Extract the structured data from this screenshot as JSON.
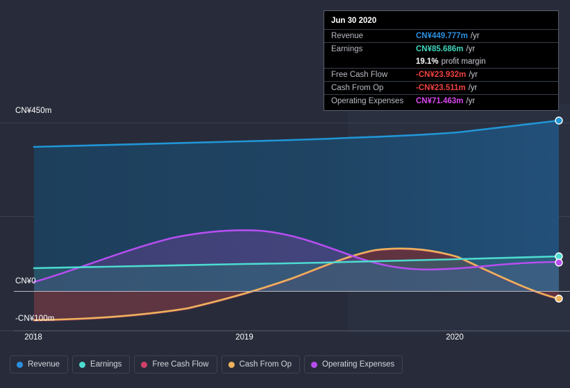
{
  "chart_data": {
    "type": "area",
    "title": "",
    "xlabel": "",
    "ylabel": "",
    "currency_prefix": "CN¥",
    "x_ticks": [
      "2018",
      "2019",
      "2020"
    ],
    "x_tick_positions": [
      48,
      352,
      655
    ],
    "y_ticks": [
      "CN¥450m",
      "CN¥0",
      "-CN¥100m"
    ],
    "y_tick_values": [
      450,
      0,
      -100
    ],
    "ylim": [
      -140,
      500
    ],
    "grid": true,
    "legend_position": "bottom-left",
    "units": "CN¥ millions per year",
    "x_range": [
      "2018-01-01",
      "2020-09-30"
    ],
    "marker_date": "Jun 30 2020",
    "series": [
      {
        "name": "Revenue",
        "color": "#2196d6",
        "fill": "#1f4261",
        "x": [
          2018.0,
          2018.5,
          2019.0,
          2019.5,
          2020.0,
          2020.25,
          2020.5,
          2020.75
        ],
        "values": [
          372,
          375,
          378,
          381,
          384,
          400,
          430,
          450
        ]
      },
      {
        "name": "Earnings",
        "color": "#4ddbd0",
        "fill": "#2b5d63",
        "x": [
          2018.0,
          2018.5,
          2019.0,
          2019.5,
          2020.0,
          2020.25,
          2020.5,
          2020.75
        ],
        "values": [
          55,
          56,
          58,
          60,
          62,
          70,
          80,
          86
        ]
      },
      {
        "name": "Free Cash Flow",
        "color": "#d44a72",
        "fill": "#5a3440",
        "x": [
          2018.0,
          2018.5,
          2019.0,
          2019.5,
          2020.0,
          2020.25,
          2020.5,
          2020.75
        ],
        "values": [
          -108,
          -95,
          -72,
          -30,
          18,
          24,
          5,
          -24
        ]
      },
      {
        "name": "Cash From Op",
        "color": "#e8b濾76",
        "fill": "#6b5a55",
        "x": [
          2018.0,
          2018.5,
          2019.0,
          2019.5,
          2020.0,
          2020.25,
          2020.5,
          2020.75
        ],
        "values": [
          -107,
          -94,
          -70,
          -28,
          20,
          26,
          6,
          -23
        ]
      },
      {
        "name": "Operating Expenses",
        "color": "#b64ef0",
        "fill": "#49407a",
        "x": [
          2018.0,
          2018.5,
          2019.0,
          2019.5,
          2020.0,
          2020.25,
          2020.5,
          2020.75
        ],
        "values": [
          0,
          48,
          82,
          88,
          60,
          50,
          58,
          71
        ]
      }
    ]
  },
  "tooltip": {
    "date": "Jun 30 2020",
    "rows": [
      {
        "label": "Revenue",
        "value": "CN¥449.777m",
        "unit": "/yr",
        "color": "#2a8fe0"
      },
      {
        "label": "Earnings",
        "value": "CN¥85.686m",
        "unit": "/yr",
        "color": "#3fd6bd"
      },
      {
        "label": "",
        "value": "19.1%",
        "unit": "profit margin",
        "color": "#ffffff"
      },
      {
        "label": "Free Cash Flow",
        "value": "-CN¥23.932m",
        "unit": "/yr",
        "color": "#f04040"
      },
      {
        "label": "Cash From Op",
        "value": "-CN¥23.511m",
        "unit": "/yr",
        "color": "#f04040"
      },
      {
        "label": "Operating Expenses",
        "value": "CN¥71.463m",
        "unit": "/yr",
        "color": "#d946ef"
      }
    ]
  },
  "axis": {
    "y_top_label": "CN¥450m",
    "y_zero_label": "CN¥0",
    "y_neg_label": "-CN¥100m",
    "x1": "2018",
    "x2": "2019",
    "x3": "2020"
  },
  "legend": {
    "items": [
      {
        "label": "Revenue",
        "color": "#2a8fe0"
      },
      {
        "label": "Earnings",
        "color": "#4ddbd0"
      },
      {
        "label": "Free Cash Flow",
        "color": "#d2406b"
      },
      {
        "label": "Cash From Op",
        "color": "#eeb25c"
      },
      {
        "label": "Operating Expenses",
        "color": "#b64ef0"
      }
    ]
  }
}
